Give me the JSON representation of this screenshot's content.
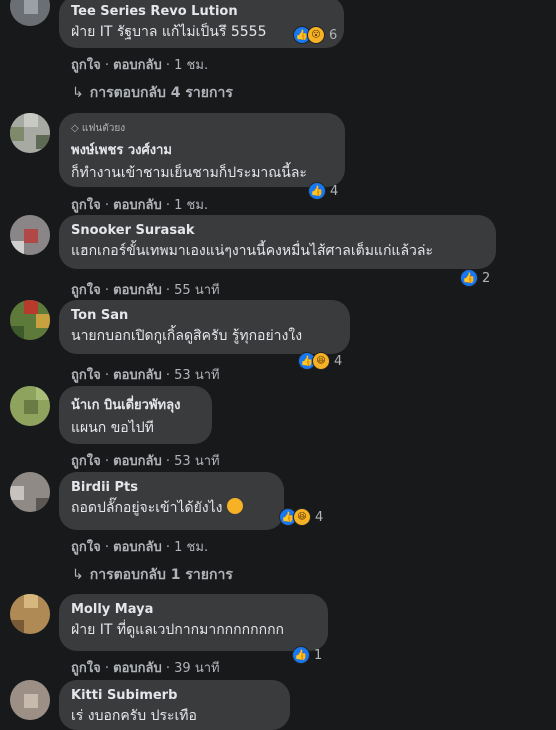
{
  "actions": {
    "like": "ถูกใจ",
    "reply": "ตอบกลับ",
    "sep": "·"
  },
  "comments": [
    {
      "name": "Tee Series Revo Lution",
      "text": "ฝ่าย IT รัฐบาล แก้ไม่เป็นรึ 5555",
      "time": "1 ชม.",
      "reactions": "6",
      "react_types": [
        "like-icon",
        "wow-icon"
      ]
    },
    {
      "fan_badge": "แฟนตัวยง",
      "name": "พงษ์เพชร วงศ์งาม",
      "text": "ก็ทำงานเข้าชามเย็นชามก็ประมาณนี้ละ",
      "time": "1 ชม.",
      "reactions": "4",
      "react_types": [
        "like-icon"
      ]
    },
    {
      "name": "Snooker Surasak",
      "text": "แฮกเกอร์ขั้นเทพมาเองแน่ๆงานนี้คงหมื่นไส้ศาลเต็มแก่แล้วล่ะ",
      "time": "55 นาที",
      "reactions": "2",
      "react_types": [
        "like-icon"
      ]
    },
    {
      "name": "Ton San",
      "text": "นายกบอกเปิดกูเกิ้ลดูสิครับ รู้ทุกอย่างใง",
      "time": "53 นาที",
      "reactions": "4",
      "react_types": [
        "like-icon",
        "haha-icon"
      ]
    },
    {
      "name": "น้าเก บินเดี่ยวพัทลุง",
      "text": "แผนก ขอไปที",
      "time": "53 นาที"
    },
    {
      "name": "Birdii Pts",
      "text": "ถอดปลั๊กอยู่จะเข้าได้ยังไง",
      "time": "1 ชม.",
      "reactions": "4",
      "react_types": [
        "like-icon",
        "haha-icon"
      ]
    },
    {
      "name": "Molly Maya",
      "text": "ฝ่าย IT ที่ดูแลเวปกากมากกกกกกกก",
      "time": "39 นาที",
      "reactions": "1",
      "react_types": [
        "like-icon"
      ]
    },
    {
      "name": "Kitti Subimerb",
      "text": "เร่ งบอกครับ ประเทือ"
    }
  ],
  "reply_links": [
    "การตอบกลับ 4 รายการ",
    "การตอบกลับ 1 รายการ"
  ],
  "colors": {
    "background": "#18191a",
    "bubble": "#3a3b3c",
    "text": "#e4e6eb",
    "muted": "#b0b3b8",
    "like": "#1877f2",
    "emoji": "#f7b125"
  }
}
